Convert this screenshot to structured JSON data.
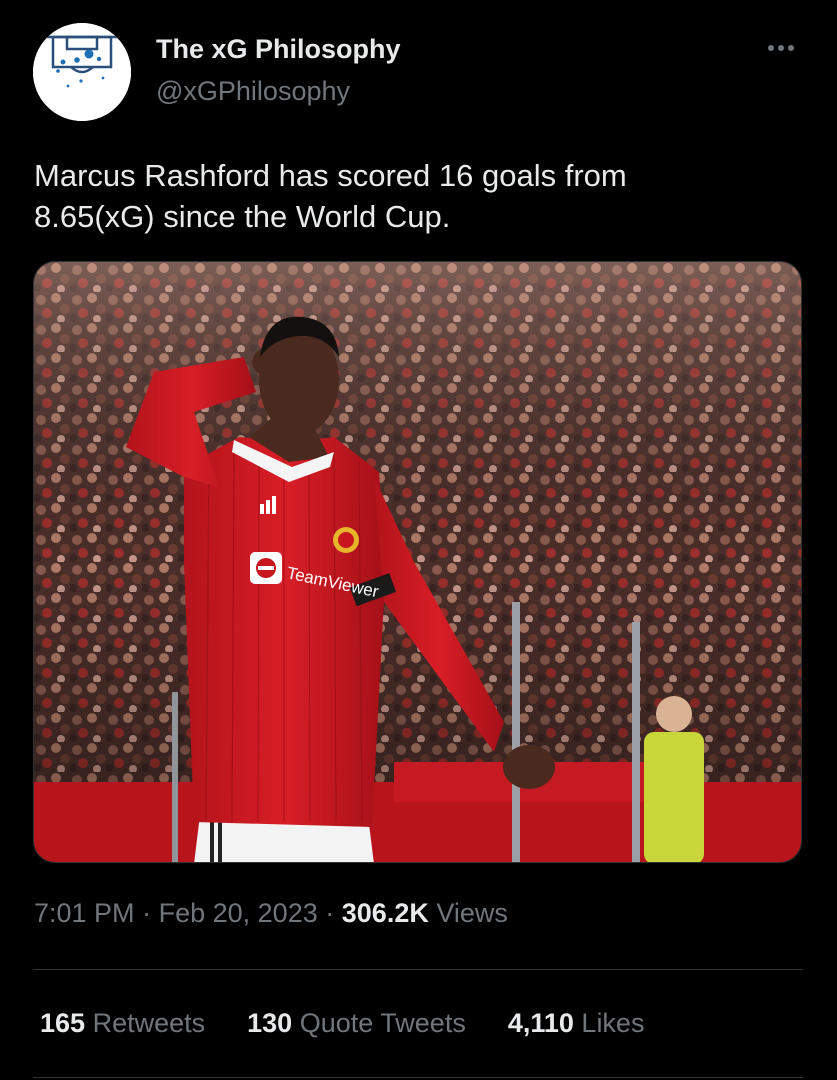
{
  "author": {
    "display_name": "The xG Philosophy",
    "handle": "@xGPhilosophy",
    "avatar_icon": "pitch-shot-map-icon"
  },
  "tweet": {
    "text": "Marcus Rashford has scored 16 goals from\n8.65(xG) since the World Cup."
  },
  "media": {
    "kit_text": "TeamViewer",
    "sponsor_brand": "adidas"
  },
  "meta": {
    "time": "7:01 PM",
    "separator": "·",
    "date": "Feb 20, 2023",
    "views_count": "306.2K",
    "views_label": "Views"
  },
  "stats": {
    "retweets_count": "165",
    "retweets_label": "Retweets",
    "quotes_count": "130",
    "quotes_label": "Quote Tweets",
    "likes_count": "4,110",
    "likes_label": "Likes"
  },
  "colors": {
    "background": "#000000",
    "primary_text": "#e7e9ea",
    "secondary_text": "#71767b",
    "divider": "#2f3336",
    "kit_red": "#c8161e"
  }
}
